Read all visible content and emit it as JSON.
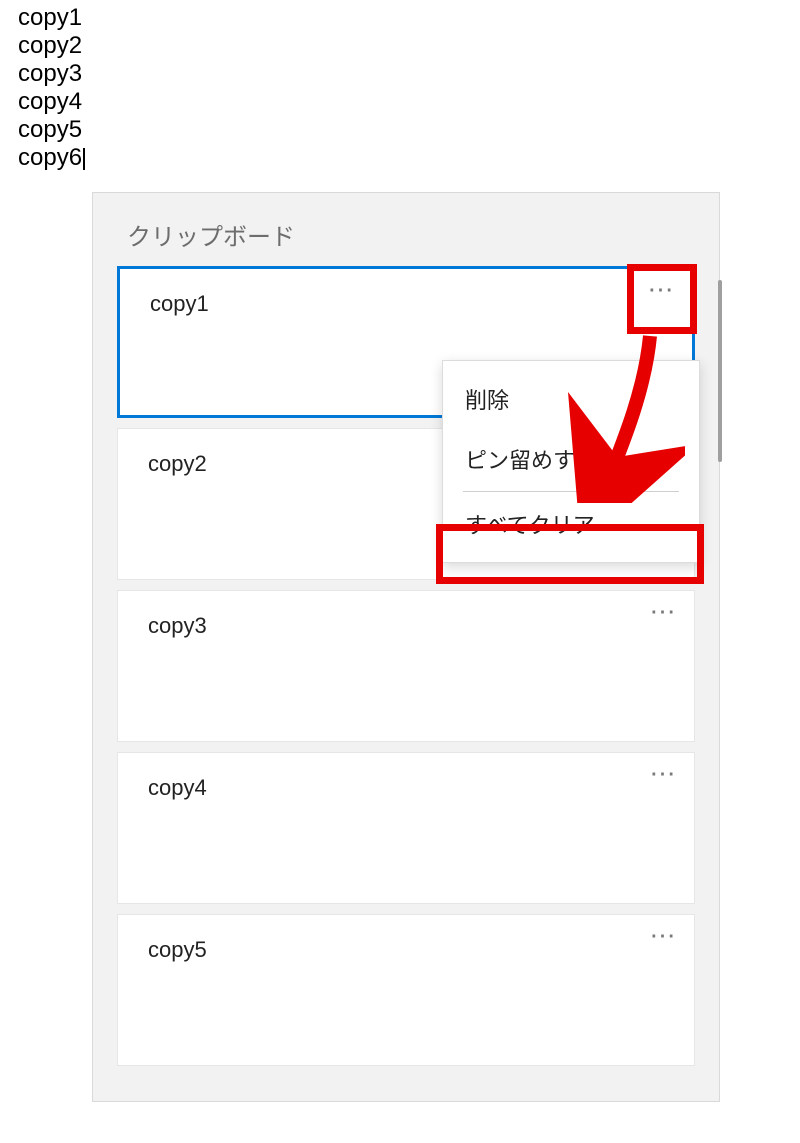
{
  "editor": {
    "lines": [
      "copy1",
      "copy2",
      "copy3",
      "copy4",
      "copy5",
      "copy6"
    ]
  },
  "clipboard": {
    "title": "クリップボード",
    "items": [
      {
        "text": "copy1",
        "selected": true
      },
      {
        "text": "copy2",
        "selected": false
      },
      {
        "text": "copy3",
        "selected": false
      },
      {
        "text": "copy4",
        "selected": false
      },
      {
        "text": "copy5",
        "selected": false
      }
    ],
    "more_glyph": "⋯"
  },
  "menu": {
    "delete": "削除",
    "pin": "ピン留めする",
    "clear_all": "すべてクリア"
  },
  "colors": {
    "highlight_red": "#e60000",
    "selection_blue": "#0078d7"
  }
}
